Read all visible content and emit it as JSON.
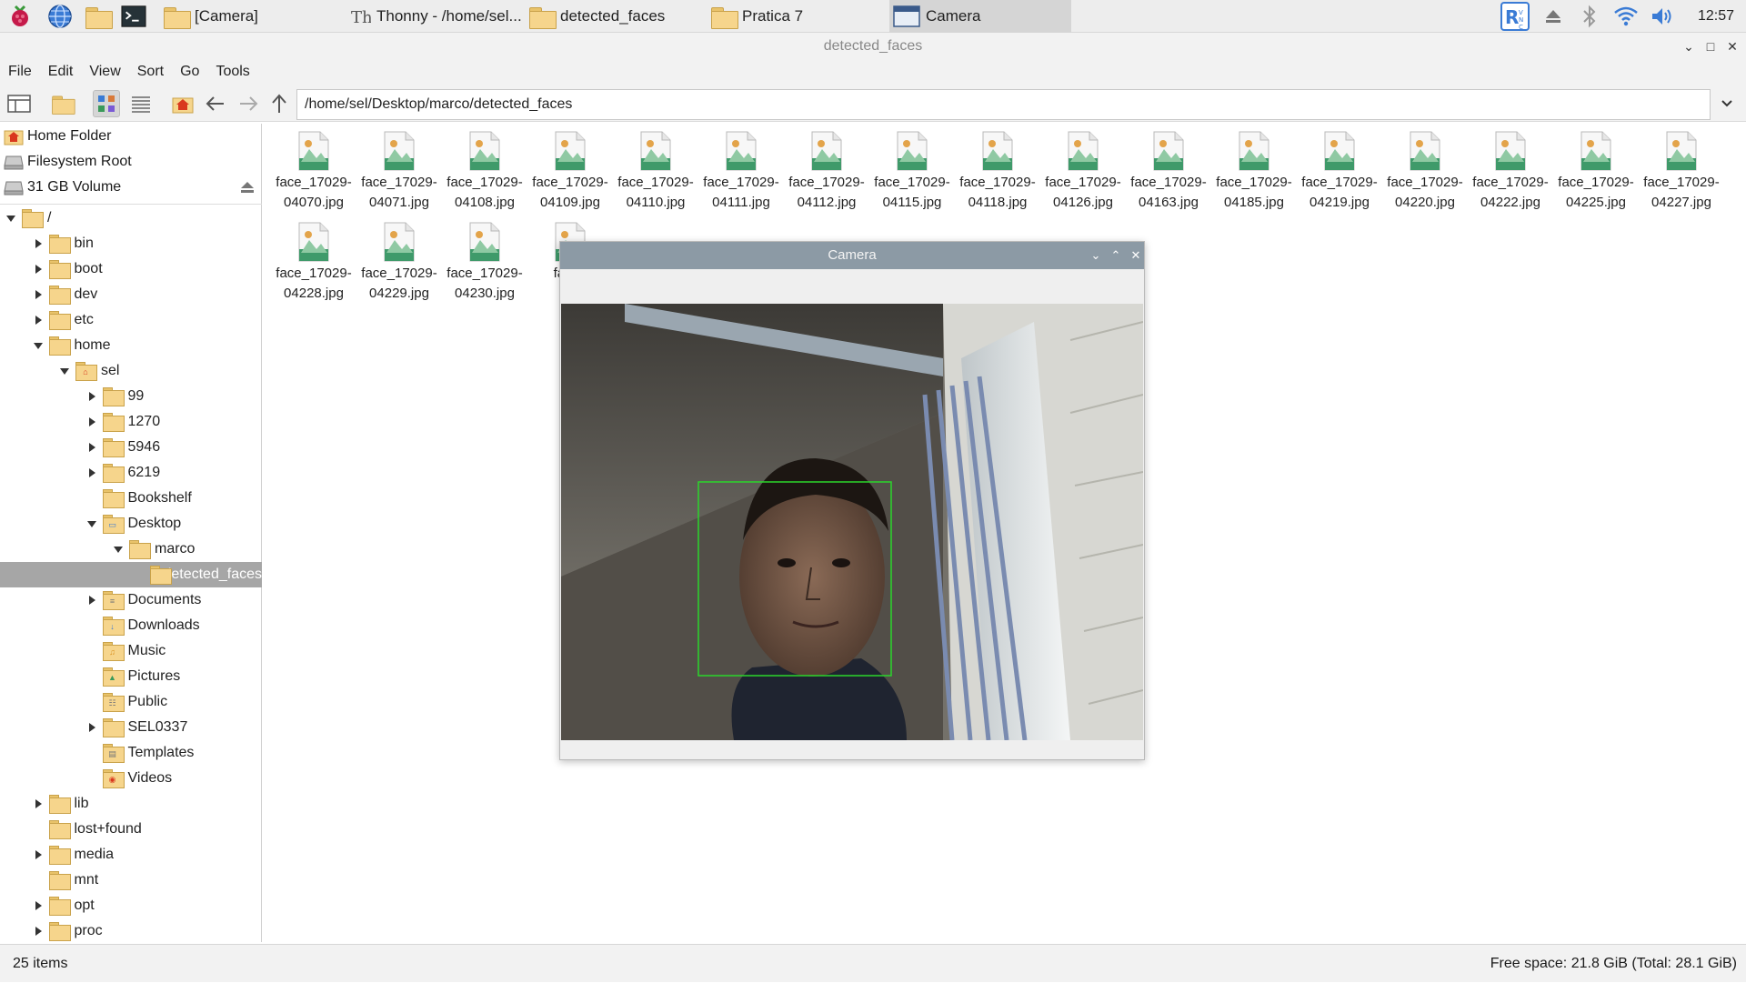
{
  "taskbar": {
    "launchers": [
      "raspberry-menu-icon",
      "web-browser-icon",
      "file-manager-icon",
      "terminal-icon"
    ],
    "tasks": [
      {
        "label": "[Camera]",
        "icon": "folder-icon"
      },
      {
        "label": "Thonny  -  /home/sel...",
        "icon": "thonny-icon"
      },
      {
        "label": "detected_faces",
        "icon": "folder-icon"
      },
      {
        "label": "Pratica 7",
        "icon": "folder-icon"
      },
      {
        "label": "Camera",
        "icon": "window-icon"
      }
    ],
    "tray": [
      "vnc-icon",
      "eject-icon",
      "bluetooth-icon",
      "wifi-icon",
      "volume-icon"
    ],
    "clock": "12:57"
  },
  "window": {
    "title": "detected_faces",
    "menu": [
      "File",
      "Edit",
      "View",
      "Sort",
      "Go",
      "Tools"
    ],
    "path": "/home/sel/Desktop/marco/detected_faces"
  },
  "places": [
    {
      "label": "Home Folder",
      "icon": "home-icon"
    },
    {
      "label": "Filesystem Root",
      "icon": "drive-icon"
    },
    {
      "label": "31 GB Volume",
      "icon": "drive-icon"
    }
  ],
  "tree": [
    {
      "label": "/",
      "level": 0,
      "expander": "open"
    },
    {
      "label": "bin",
      "level": 1,
      "expander": "closed"
    },
    {
      "label": "boot",
      "level": 1,
      "expander": "closed"
    },
    {
      "label": "dev",
      "level": 1,
      "expander": "closed"
    },
    {
      "label": "etc",
      "level": 1,
      "expander": "closed"
    },
    {
      "label": "home",
      "level": 1,
      "expander": "open"
    },
    {
      "label": "sel",
      "level": 2,
      "expander": "open",
      "mini": "home"
    },
    {
      "label": "99",
      "level": 3,
      "expander": "closed"
    },
    {
      "label": "1270",
      "level": 3,
      "expander": "closed"
    },
    {
      "label": "5946",
      "level": 3,
      "expander": "closed"
    },
    {
      "label": "6219",
      "level": 3,
      "expander": "closed"
    },
    {
      "label": "Bookshelf",
      "level": 3,
      "expander": "none"
    },
    {
      "label": "Desktop",
      "level": 3,
      "expander": "open",
      "mini": "desktop"
    },
    {
      "label": "marco",
      "level": 4,
      "expander": "open"
    },
    {
      "label": "detected_faces",
      "level": 5,
      "expander": "none",
      "selected": true
    },
    {
      "label": "Documents",
      "level": 3,
      "expander": "closed",
      "mini": "documents"
    },
    {
      "label": "Downloads",
      "level": 3,
      "expander": "none",
      "mini": "downloads"
    },
    {
      "label": "Music",
      "level": 3,
      "expander": "none",
      "mini": "music"
    },
    {
      "label": "Pictures",
      "level": 3,
      "expander": "none",
      "mini": "pictures"
    },
    {
      "label": "Public",
      "level": 3,
      "expander": "none",
      "mini": "public"
    },
    {
      "label": "SEL0337",
      "level": 3,
      "expander": "closed"
    },
    {
      "label": "Templates",
      "level": 3,
      "expander": "none",
      "mini": "templates"
    },
    {
      "label": "Videos",
      "level": 3,
      "expander": "none",
      "mini": "videos"
    },
    {
      "label": "lib",
      "level": 1,
      "expander": "closed"
    },
    {
      "label": "lost+found",
      "level": 1,
      "expander": "none"
    },
    {
      "label": "media",
      "level": 1,
      "expander": "closed"
    },
    {
      "label": "mnt",
      "level": 1,
      "expander": "none"
    },
    {
      "label": "opt",
      "level": 1,
      "expander": "closed"
    },
    {
      "label": "proc",
      "level": 1,
      "expander": "closed"
    }
  ],
  "files": [
    {
      "line1": "face_17029-",
      "line2": "04070.jpg"
    },
    {
      "line1": "face_17029-",
      "line2": "04071.jpg"
    },
    {
      "line1": "face_17029-",
      "line2": "04108.jpg"
    },
    {
      "line1": "face_17029-",
      "line2": "04109.jpg"
    },
    {
      "line1": "face_17029-",
      "line2": "04110.jpg"
    },
    {
      "line1": "face_17029-",
      "line2": "04111.jpg"
    },
    {
      "line1": "face_17029-",
      "line2": "04112.jpg"
    },
    {
      "line1": "face_17029-",
      "line2": "04115.jpg"
    },
    {
      "line1": "face_17029-",
      "line2": "04118.jpg"
    },
    {
      "line1": "face_17029-",
      "line2": "04126.jpg"
    },
    {
      "line1": "face_17029-",
      "line2": "04163.jpg"
    },
    {
      "line1": "face_17029-",
      "line2": "04185.jpg"
    },
    {
      "line1": "face_17029-",
      "line2": "04219.jpg"
    },
    {
      "line1": "face_17029-",
      "line2": "04220.jpg"
    },
    {
      "line1": "face_17029-",
      "line2": "04222.jpg"
    },
    {
      "line1": "face_17029-",
      "line2": "04225.jpg"
    },
    {
      "line1": "face_17029-",
      "line2": "04227.jpg"
    },
    {
      "line1": "face_17029-",
      "line2": "04228.jpg"
    },
    {
      "line1": "face_17029-",
      "line2": "04229.jpg"
    },
    {
      "line1": "face_17029-",
      "line2": "04230.jpg"
    },
    {
      "line1": "face_",
      "line2": "042"
    }
  ],
  "camera": {
    "title": "Camera",
    "detection_box_color": "#2bd62b"
  },
  "status": {
    "items": "25 items",
    "free_space": "Free space: 21.8 GiB (Total: 28.1 GiB)"
  },
  "colors": {
    "folder": "#f6d58c",
    "selection": "#a6a6a6",
    "camera_titlebar": "#8c9aa5",
    "image_icon_green": "#3f9a6a"
  }
}
